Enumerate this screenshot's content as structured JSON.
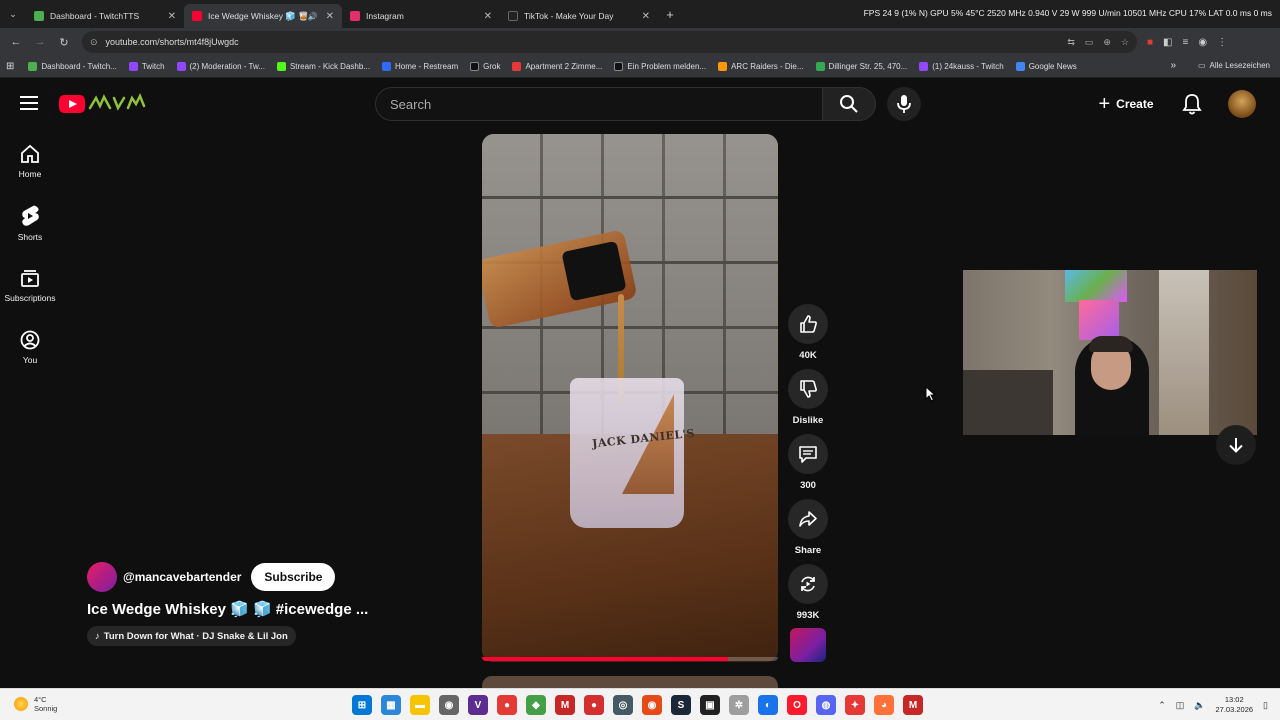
{
  "browser": {
    "tabs": [
      {
        "title": "Dashboard - TwitchTTS",
        "favicon_color": "#4caf50",
        "active": false
      },
      {
        "title": "Ice Wedge Whiskey 🧊 🥃",
        "favicon_color": "#ff0033",
        "active": true,
        "audio": true
      },
      {
        "title": "Instagram",
        "favicon_color": "#e1306c",
        "active": false
      },
      {
        "title": "TikTok - Make Your Day",
        "favicon_color": "#222222",
        "active": false
      }
    ],
    "perf_overlay": "FPS 24   9 (1% N)    GPU 5%  45°C  2520 MHz  0.940 V  29 W  999 U/min  10501 MHz     CPU 17%     LAT 0.0 ms  0 ms",
    "url": "youtube.com/shorts/mt4f8jUwgdc",
    "bookmarks": [
      {
        "label": "Dashboard - Twitch...",
        "color": "#4caf50"
      },
      {
        "label": "Twitch",
        "color": "#9146ff"
      },
      {
        "label": "(2) Moderation - Tw...",
        "color": "#9146ff"
      },
      {
        "label": "Stream - Kick Dashb...",
        "color": "#53fc18"
      },
      {
        "label": "Home - Restream",
        "color": "#2f6bff"
      },
      {
        "label": "Grok",
        "color": "#333333"
      },
      {
        "label": "Apartment 2 Zimme...",
        "color": "#e53935"
      },
      {
        "label": "Ein Problem melden...",
        "color": "#222222"
      },
      {
        "label": "ARC Raiders - Die...",
        "color": "#ff9800"
      },
      {
        "label": "Dillinger Str. 25, 470...",
        "color": "#34a853"
      },
      {
        "label": "(1) 24kauss - Twitch",
        "color": "#9146ff"
      },
      {
        "label": "Google News",
        "color": "#4285f4"
      }
    ],
    "all_bookmarks": "Alle Lesezeichen"
  },
  "yt": {
    "search_placeholder": "Search",
    "create_label": "Create",
    "nav": [
      {
        "label": "Home",
        "icon": "home-icon"
      },
      {
        "label": "Shorts",
        "icon": "shorts-icon"
      },
      {
        "label": "Subscriptions",
        "icon": "subscriptions-icon"
      },
      {
        "label": "You",
        "icon": "you-icon"
      }
    ],
    "short": {
      "channel": "@mancavebartender",
      "subscribe": "Subscribe",
      "title": "Ice Wedge Whiskey 🧊 🧊 #icewedge ...",
      "music": "Turn Down for What · DJ Snake & Lil Jon",
      "glass_label": "JACK DANIEL'S",
      "progress": 0.83
    },
    "actions": {
      "like_count": "40K",
      "dislike_label": "Dislike",
      "comment_count": "300",
      "share_label": "Share",
      "remix_count": "993K"
    }
  },
  "taskbar": {
    "weather_temp": "4°C",
    "weather_text": "Sonnig",
    "time": "13:02",
    "date": "27.03.2026",
    "app_icons": [
      {
        "name": "windows-start-icon",
        "color": "#0078d4",
        "glyph": "⊞"
      },
      {
        "name": "calculator-icon",
        "color": "#2b88d8",
        "glyph": "▦"
      },
      {
        "name": "file-explorer-icon",
        "color": "#f8c400",
        "glyph": "▬"
      },
      {
        "name": "mouse-app-icon",
        "color": "#666666",
        "glyph": "◉"
      },
      {
        "name": "visual-studio-icon",
        "color": "#5c2d91",
        "glyph": "V"
      },
      {
        "name": "app-red-icon",
        "color": "#e53935",
        "glyph": "●"
      },
      {
        "name": "app-green-icon",
        "color": "#43a047",
        "glyph": "◆"
      },
      {
        "name": "msi-afterburner-icon",
        "color": "#c62828",
        "glyph": "M"
      },
      {
        "name": "app-circle-red-icon",
        "color": "#d32f2f",
        "glyph": "●"
      },
      {
        "name": "app-target-icon",
        "color": "#455a64",
        "glyph": "◎"
      },
      {
        "name": "app-orange-icon",
        "color": "#e64a19",
        "glyph": "◉"
      },
      {
        "name": "steam-icon",
        "color": "#1b2838",
        "glyph": "S"
      },
      {
        "name": "app-dark-icon",
        "color": "#212121",
        "glyph": "▣"
      },
      {
        "name": "app-gear-icon",
        "color": "#9e9e9e",
        "glyph": "✲"
      },
      {
        "name": "chrome-icon",
        "color": "#1a73e8",
        "glyph": "◐"
      },
      {
        "name": "opera-icon",
        "color": "#ff1b2d",
        "glyph": "O"
      },
      {
        "name": "discord-icon",
        "color": "#5865f2",
        "glyph": "◍"
      },
      {
        "name": "app-paw-icon",
        "color": "#e53935",
        "glyph": "✦"
      },
      {
        "name": "firefox-icon",
        "color": "#ff7139",
        "glyph": "◕"
      },
      {
        "name": "app-msi-icon",
        "color": "#c62828",
        "glyph": "M"
      }
    ]
  }
}
